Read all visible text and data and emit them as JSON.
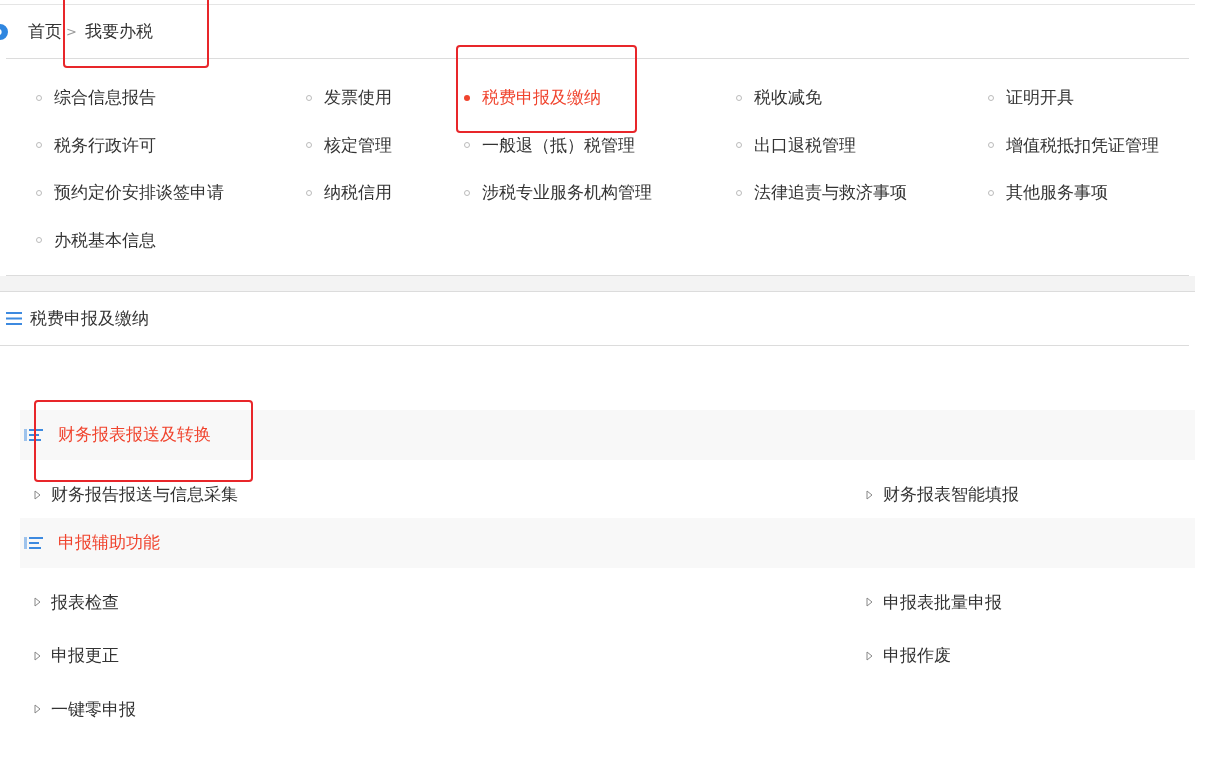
{
  "breadcrumb": {
    "separator": ">",
    "items": [
      {
        "label": "首页",
        "highlighted": false
      },
      {
        "label": "我要办税",
        "highlighted": true
      }
    ]
  },
  "menu": [
    {
      "label": "综合信息报告",
      "selected": false,
      "highlighted": false
    },
    {
      "label": "发票使用",
      "selected": false,
      "highlighted": false
    },
    {
      "label": "税费申报及缴纳",
      "selected": true,
      "highlighted": true
    },
    {
      "label": "税收减免",
      "selected": false,
      "highlighted": false
    },
    {
      "label": "证明开具",
      "selected": false,
      "highlighted": false
    },
    {
      "label": "税务行政许可",
      "selected": false,
      "highlighted": false
    },
    {
      "label": "核定管理",
      "selected": false,
      "highlighted": false
    },
    {
      "label": "一般退（抵）税管理",
      "selected": false,
      "highlighted": false
    },
    {
      "label": "出口退税管理",
      "selected": false,
      "highlighted": false
    },
    {
      "label": "增值税抵扣凭证管理",
      "selected": false,
      "highlighted": false
    },
    {
      "label": "预约定价安排谈签申请",
      "selected": false,
      "highlighted": false
    },
    {
      "label": "纳税信用",
      "selected": false,
      "highlighted": false
    },
    {
      "label": "涉税专业服务机构管理",
      "selected": false,
      "highlighted": false
    },
    {
      "label": "法律追责与救济事项",
      "selected": false,
      "highlighted": false
    },
    {
      "label": "其他服务事项",
      "selected": false,
      "highlighted": false
    },
    {
      "label": "办税基本信息",
      "selected": false,
      "highlighted": false
    }
  ],
  "panel_title": "税费申报及缴纳",
  "sections": [
    {
      "title": "财务报表报送及转换",
      "highlighted": true,
      "items": [
        "财务报告报送与信息采集",
        "财务报表智能填报"
      ]
    },
    {
      "title": "申报辅助功能",
      "highlighted": false,
      "items": [
        "报表检查",
        "申报表批量申报",
        "申报更正",
        "申报作废",
        "一键零申报"
      ]
    }
  ]
}
